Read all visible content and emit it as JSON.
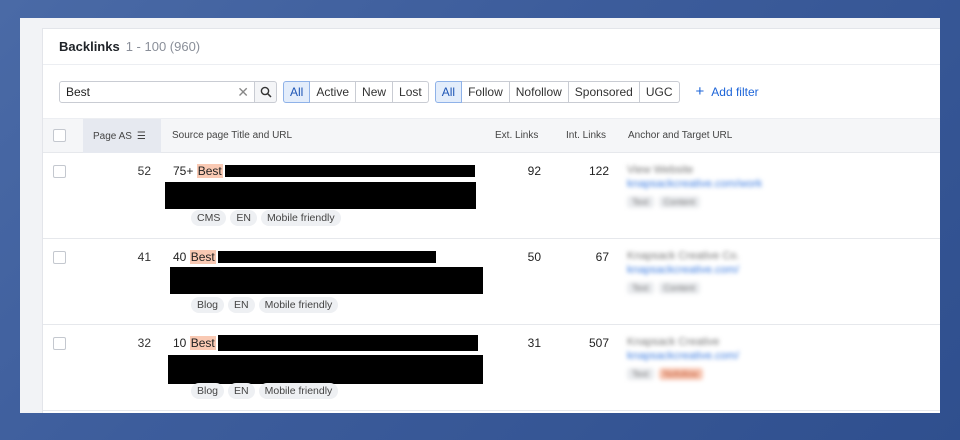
{
  "header": {
    "title": "Backlinks",
    "range": "1 - 100 (960)"
  },
  "toolbar": {
    "search_value": "Best",
    "status_filters": [
      "All",
      "Active",
      "New",
      "Lost"
    ],
    "type_filters": [
      "All",
      "Follow",
      "Nofollow",
      "Sponsored",
      "UGC"
    ],
    "add_filter": "Add filter"
  },
  "table": {
    "columns": {
      "page_as": "Page AS",
      "source": "Source page Title and URL",
      "ext": "Ext. Links",
      "int": "Int. Links",
      "anchor": "Anchor and Target URL"
    },
    "rows": [
      {
        "page_as": "52",
        "prefix": "75+",
        "highlight": "Best",
        "ext": "92",
        "int": "122",
        "tags": [
          "CMS",
          "EN",
          "Mobile friendly"
        ],
        "anchor_text": "View Website",
        "target_url": "knapsackcreative.com/work",
        "chips": [
          "Text",
          "Content"
        ]
      },
      {
        "page_as": "41",
        "prefix": "40",
        "highlight": "Best",
        "ext": "50",
        "int": "67",
        "tags": [
          "Blog",
          "EN",
          "Mobile friendly"
        ],
        "anchor_text": "Knapsack Creative Co.",
        "target_url": "knapsackcreative.com/",
        "chips": [
          "Text",
          "Content"
        ]
      },
      {
        "page_as": "32",
        "prefix": "10",
        "highlight": "Best",
        "ext": "31",
        "int": "507",
        "tags": [
          "Blog",
          "EN",
          "Mobile friendly"
        ],
        "anchor_text": "Knapsack Creative",
        "target_url": "knapsackcreative.com/",
        "chips": [
          "Text",
          "Nofollow"
        ]
      }
    ]
  }
}
